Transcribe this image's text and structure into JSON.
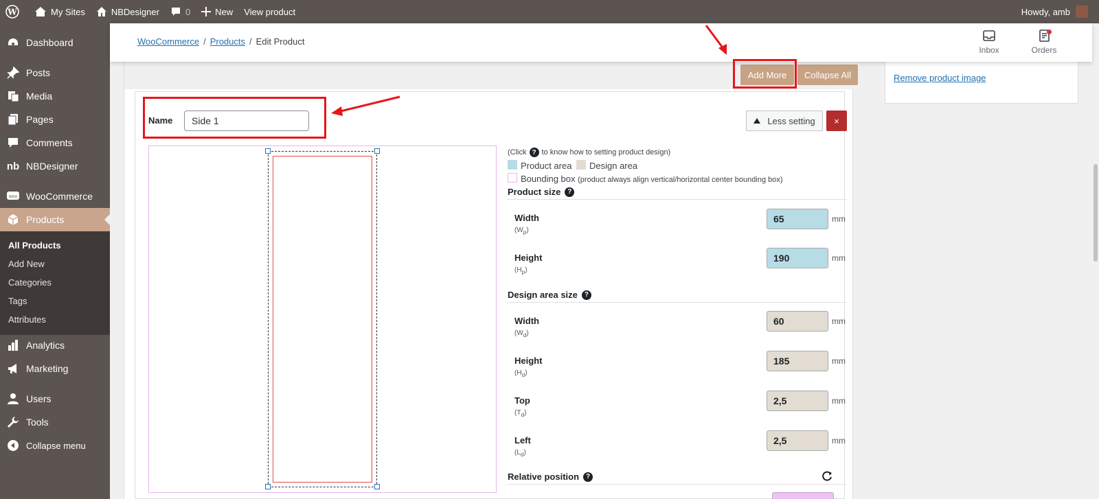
{
  "adminbar": {
    "my_sites": "My Sites",
    "site_name": "NBDesigner",
    "comments_count": "0",
    "new_label": "New",
    "view_product": "View product",
    "howdy": "Howdy, amb"
  },
  "sidebar": {
    "items": [
      {
        "label": "Dashboard",
        "icon": "dashboard-icon"
      },
      {
        "label": "Posts",
        "icon": "pin-icon"
      },
      {
        "label": "Media",
        "icon": "media-icon"
      },
      {
        "label": "Pages",
        "icon": "pages-icon"
      },
      {
        "label": "Comments",
        "icon": "comment-icon"
      },
      {
        "label": "NBDesigner",
        "icon": "nb-icon"
      },
      {
        "label": "WooCommerce",
        "icon": "woo-icon"
      },
      {
        "label": "Products",
        "icon": "box-icon"
      },
      {
        "label": "Analytics",
        "icon": "chart-icon"
      },
      {
        "label": "Marketing",
        "icon": "megaphone-icon"
      },
      {
        "label": "Users",
        "icon": "user-icon"
      },
      {
        "label": "Tools",
        "icon": "wrench-icon"
      },
      {
        "label": "Collapse menu",
        "icon": "collapse-icon"
      }
    ],
    "submenu": [
      "All Products",
      "Add New",
      "Categories",
      "Tags",
      "Attributes"
    ]
  },
  "header": {
    "breadcrumb": [
      "WooCommerce",
      "Products",
      "Edit Product"
    ],
    "inbox": "Inbox",
    "orders": "Orders"
  },
  "toolbar": {
    "add_more": "Add More",
    "collapse_all": "Collapse All"
  },
  "side": {
    "name_label": "Name",
    "name_value": "Side 1",
    "less_setting": "Less setting",
    "close": "×"
  },
  "settings": {
    "click_note_pre": "(Click",
    "click_note_post": "to know how to setting product design)",
    "legend_product": "Product area",
    "legend_design": "Design area",
    "legend_bbox": "Bounding box",
    "legend_bbox_note": "(product always align vertical/horizontal center bounding box)",
    "product_size": "Product size",
    "design_area_size": "Design area size",
    "relative_position": "Relative position",
    "unit": "mm",
    "product_fields": [
      {
        "label": "Width",
        "sub": "(W",
        "subscript": "p",
        "value": "65"
      },
      {
        "label": "Height",
        "sub": "(H",
        "subscript": "p",
        "value": "190"
      }
    ],
    "design_fields": [
      {
        "label": "Width",
        "sub": "(W",
        "subscript": "d",
        "value": "60"
      },
      {
        "label": "Height",
        "sub": "(H",
        "subscript": "d",
        "value": "185"
      },
      {
        "label": "Top",
        "sub": "(T",
        "subscript": "d",
        "value": "2,5"
      },
      {
        "label": "Left",
        "sub": "(L",
        "subscript": "d",
        "value": "2,5"
      }
    ],
    "colors": {
      "product_area": "#b8dce6",
      "design_area": "#e2dcd2",
      "bounding_box": "#e8b4f0"
    }
  },
  "rightcol": {
    "remove_image": "Remove product image"
  }
}
